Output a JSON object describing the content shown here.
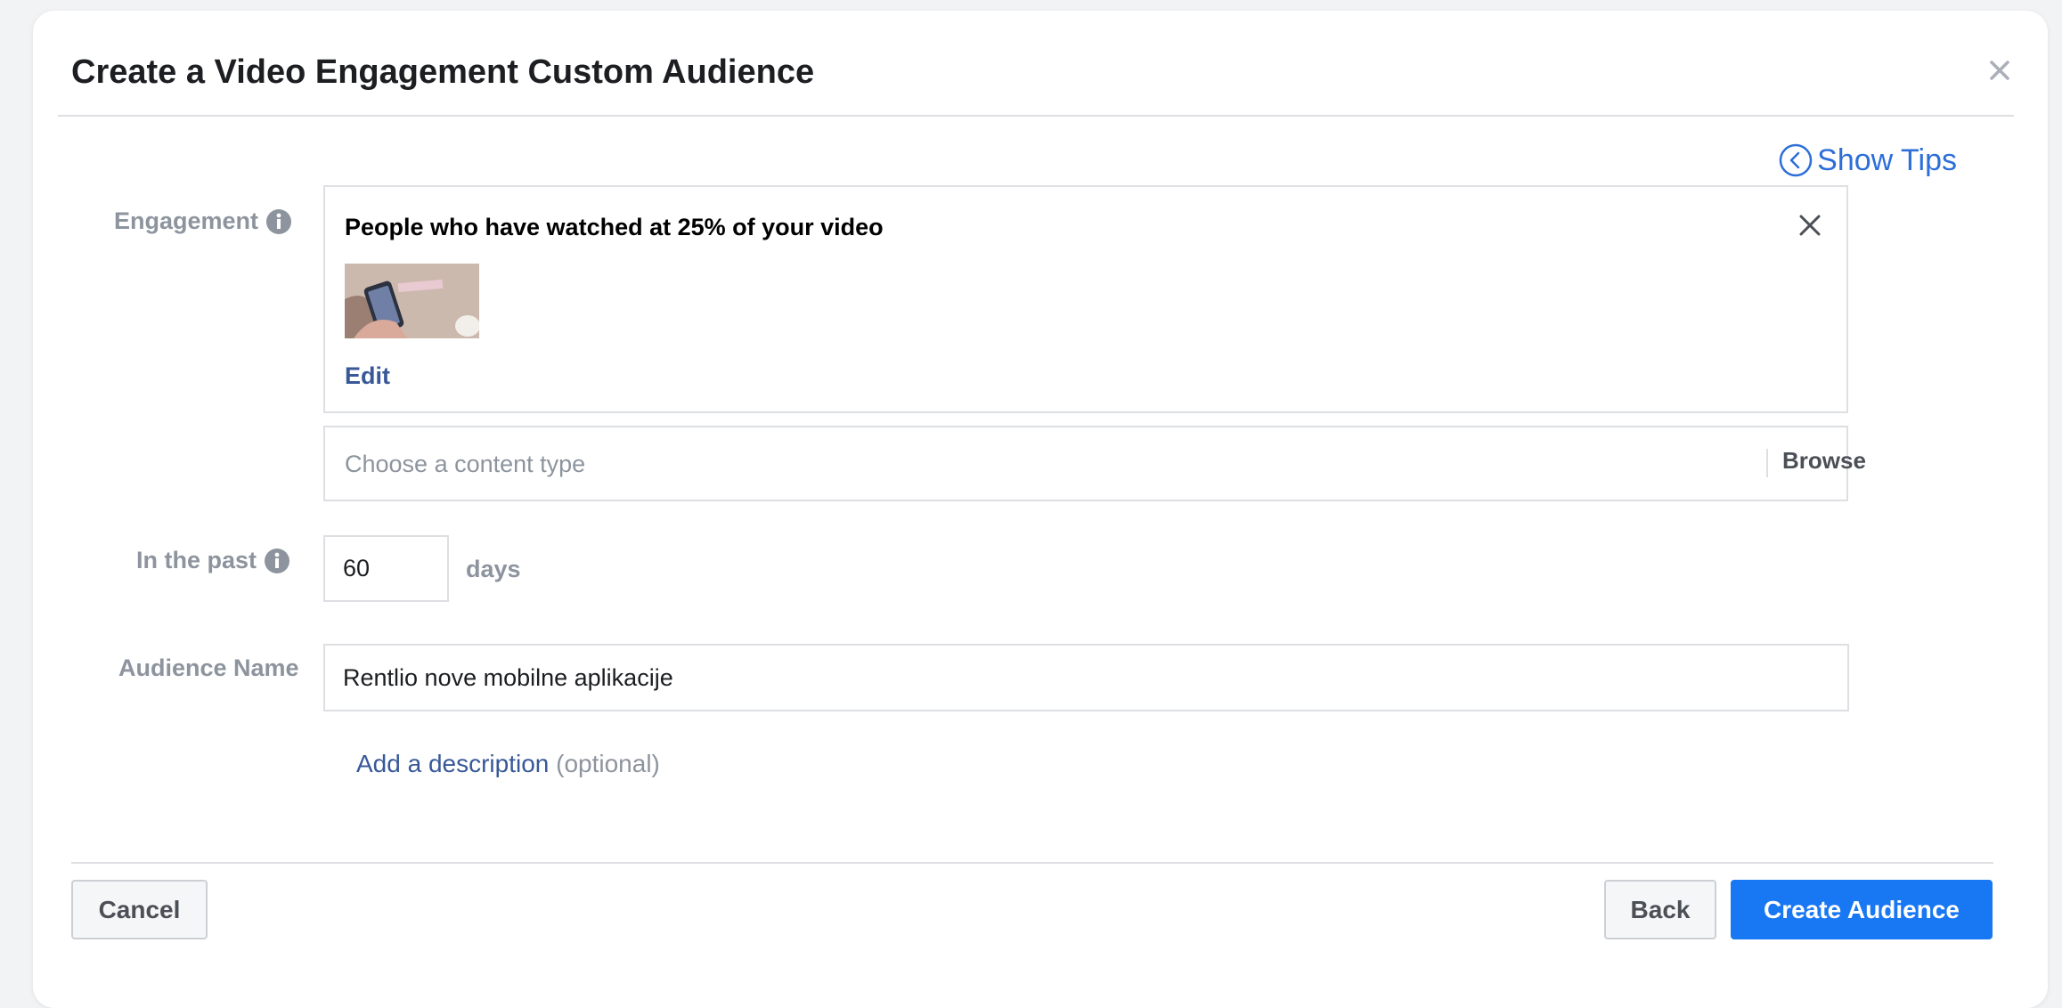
{
  "dialog": {
    "title": "Create a Video Engagement Custom Audience",
    "close_icon": "close-icon",
    "show_tips_label": "Show Tips"
  },
  "engagement": {
    "label": "Engagement",
    "selected_title": "People who have watched at 25% of your video",
    "edit_label": "Edit",
    "content_type_placeholder": "Choose a content type",
    "browse_label": "Browse"
  },
  "retention": {
    "label": "In the past",
    "value": "60",
    "unit": "days"
  },
  "audience_name": {
    "label": "Audience Name",
    "value": "Rentlio nove mobilne aplikacije"
  },
  "description": {
    "link": "Add a description",
    "optional": "(optional)"
  },
  "footer": {
    "cancel_label": "Cancel",
    "back_label": "Back",
    "create_label": "Create Audience"
  },
  "colors": {
    "primary": "#1877f2",
    "link": "#385898",
    "tips_link": "#2d6ed8",
    "muted_label": "#8d949e",
    "border": "#dddfe2"
  }
}
